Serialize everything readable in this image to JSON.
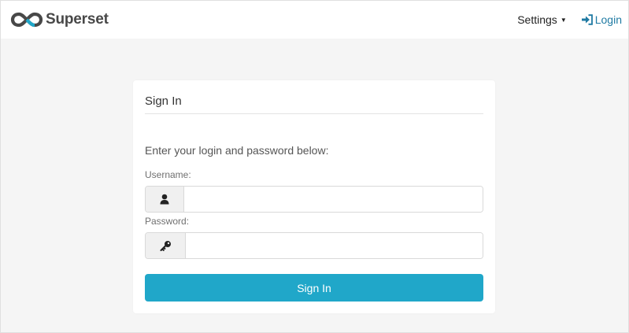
{
  "navbar": {
    "brand": "Superset",
    "settings_label": "Settings",
    "login_label": "Login"
  },
  "login_card": {
    "title": "Sign In",
    "intro": "Enter your login and password below:",
    "username_label": "Username:",
    "username_value": "",
    "password_label": "Password:",
    "password_value": "",
    "submit_label": "Sign In"
  },
  "colors": {
    "accent": "#20a7c9",
    "link": "#1f7aa3",
    "logo_dark": "#484848",
    "logo_blue": "#20a7c9",
    "background": "#f5f5f5"
  },
  "icons": {
    "brand": "superset-infinity-logo-icon",
    "settings_caret": "caret-down-icon",
    "login": "sign-in-icon",
    "username": "user-icon",
    "password": "key-icon"
  }
}
